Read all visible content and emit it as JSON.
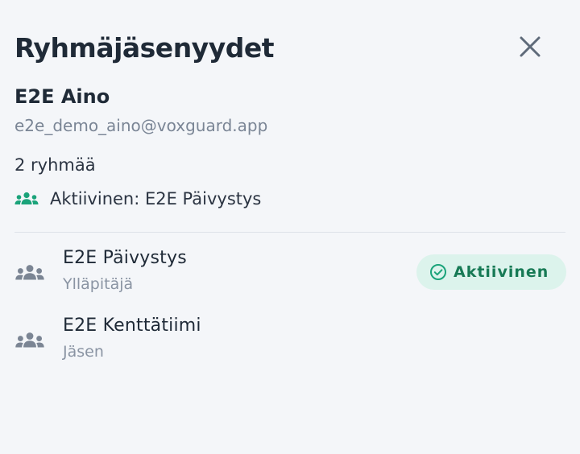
{
  "header": {
    "title": "Ryhmäjäsenyydet"
  },
  "user": {
    "name": "E2E Aino",
    "email": "e2e_demo_aino@voxguard.app",
    "group_count": "2 ryhmää",
    "active_text": "Aktiivinen: E2E Päivystys"
  },
  "groups": [
    {
      "name": "E2E Päivystys",
      "role": "Ylläpitäjä",
      "badge": "Aktiivinen"
    },
    {
      "name": "E2E Kenttätiimi",
      "role": "Jäsen"
    }
  ],
  "icons": {
    "close": "close-icon",
    "group": "group-icon",
    "check": "check-circle-icon"
  },
  "colors": {
    "accent": "#1aa37a",
    "badge_bg": "#dcf3ec",
    "badge_text": "#177a55",
    "muted_icon": "#7b8594"
  }
}
